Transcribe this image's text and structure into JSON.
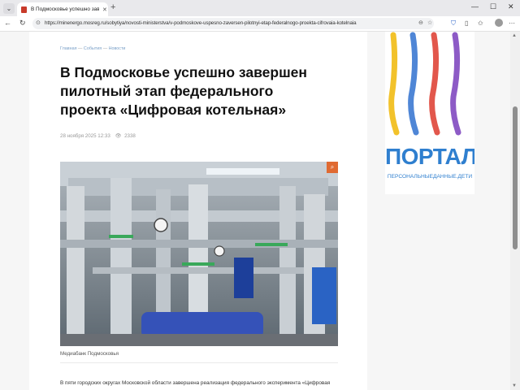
{
  "browser": {
    "tab_title": "В Подмосковье успешно завер...",
    "url": "https://minenergo.mosreg.ru/sobytiya/novosti-ministerstva/v-podmoskove-uspesno-zaversen-pilotnyi-etap-federalnogo-proekta-cifrovaia-kotelnaia"
  },
  "article": {
    "breadcrumb": [
      "Главная",
      "События",
      "Новости"
    ],
    "title": "В Подмосковье успешно завершен пилотный этап федерального проекта «Цифровая котельная»",
    "date": "28 ноября 2025 12:33",
    "views": "2338",
    "photo_caption": "Медиабанк Подмосковья",
    "lead_text": "В пяти городских округах Московской области завершена реализация федерального эксперимента «Цифровая"
  },
  "ad": {
    "logo_text": "ПОРТАЛ",
    "subtitle": "ПЕРСОНАЛЬНЫЕДАННЫЕ.ДЕТИ"
  },
  "colors": {
    "accent": "#e06a32",
    "link": "#7aa0c8",
    "ad_blue": "#2f7fcf"
  }
}
